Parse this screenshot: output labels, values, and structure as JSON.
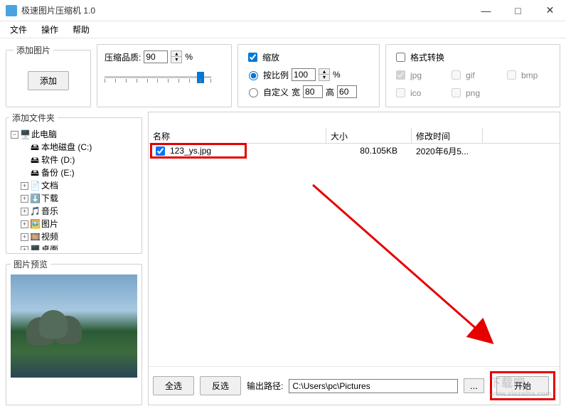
{
  "window": {
    "title": "极速图片压缩机 1.0"
  },
  "menu": {
    "file": "文件",
    "action": "操作",
    "help": "帮助"
  },
  "panels": {
    "add_image": {
      "legend": "添加图片",
      "add_btn": "添加"
    },
    "quality": {
      "label": "压缩品质:",
      "value": "90",
      "unit": "%"
    },
    "scale": {
      "checkbox": "缩放",
      "ratio_label": "按比例",
      "ratio_value": "100",
      "ratio_unit": "%",
      "custom_label": "自定义",
      "width_label": "宽",
      "width_value": "80",
      "height_label": "高",
      "height_value": "60"
    },
    "format": {
      "checkbox": "格式转换",
      "jpg": "jpg",
      "gif": "gif",
      "bmp": "bmp",
      "ico": "ico",
      "png": "png"
    }
  },
  "folder_panel": {
    "legend": "添加文件夹",
    "tree": {
      "root": "此电脑",
      "drive_c": "本地磁盘 (C:)",
      "drive_d": "软件 (D:)",
      "drive_e": "备份 (E:)",
      "docs": "文档",
      "downloads": "下载",
      "music": "音乐",
      "pictures": "图片",
      "videos": "视频",
      "desktop": "桌面"
    }
  },
  "preview": {
    "legend": "图片预览"
  },
  "list": {
    "headers": {
      "name": "名称",
      "size": "大小",
      "time": "修改时间"
    },
    "row1": {
      "name": "123_ys.jpg",
      "size": "80.105KB",
      "time": "2020年6月5..."
    }
  },
  "bottom": {
    "select_all": "全选",
    "invert": "反选",
    "path_label": "输出路径:",
    "path_value": "C:\\Users\\pc\\Pictures",
    "browse": "...",
    "start": "开始"
  },
  "watermark": {
    "main": "下载吧",
    "sub": "www.xiazaiba.com"
  }
}
